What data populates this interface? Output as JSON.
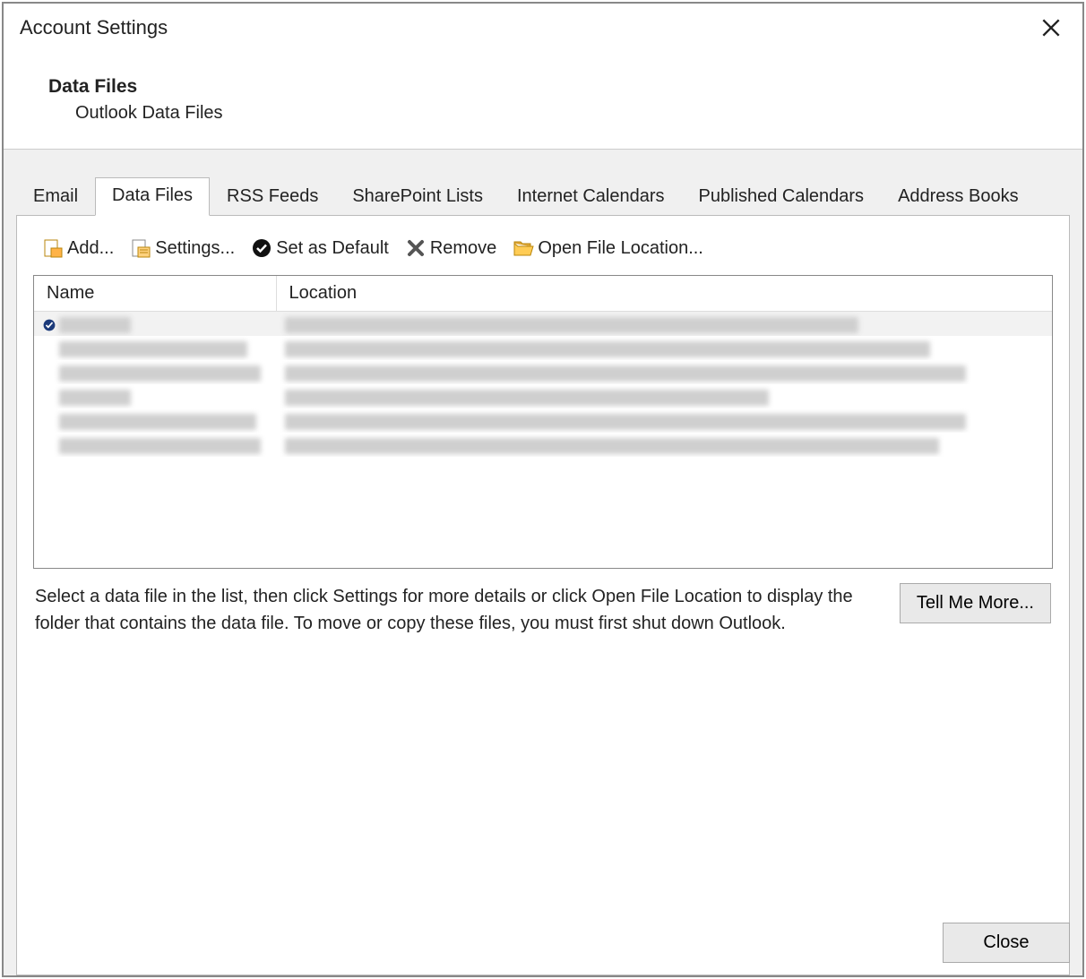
{
  "dialog": {
    "title": "Account Settings",
    "close_label": "Close"
  },
  "header": {
    "title": "Data Files",
    "subtitle": "Outlook Data Files"
  },
  "tabs": [
    {
      "id": "email",
      "label": "Email",
      "active": false
    },
    {
      "id": "data-files",
      "label": "Data Files",
      "active": true
    },
    {
      "id": "rss-feeds",
      "label": "RSS Feeds",
      "active": false
    },
    {
      "id": "sharepoint-lists",
      "label": "SharePoint Lists",
      "active": false
    },
    {
      "id": "internet-calendars",
      "label": "Internet Calendars",
      "active": false
    },
    {
      "id": "published-calendars",
      "label": "Published Calendars",
      "active": false
    },
    {
      "id": "address-books",
      "label": "Address Books",
      "active": false
    }
  ],
  "toolbar": {
    "add": "Add...",
    "settings": "Settings...",
    "set_default": "Set as Default",
    "remove": "Remove",
    "open_file_location": "Open File Location..."
  },
  "table": {
    "columns": {
      "name": "Name",
      "location": "Location"
    },
    "rows": [
      {
        "is_default": true,
        "name_redacted": true,
        "location_redacted": true,
        "selected": true,
        "name_w": 80,
        "loc_w": 640
      },
      {
        "is_default": false,
        "name_redacted": true,
        "location_redacted": true,
        "selected": false,
        "name_w": 210,
        "loc_w": 720
      },
      {
        "is_default": false,
        "name_redacted": true,
        "location_redacted": true,
        "selected": false,
        "name_w": 225,
        "loc_w": 760
      },
      {
        "is_default": false,
        "name_redacted": true,
        "location_redacted": true,
        "selected": false,
        "name_w": 80,
        "loc_w": 540
      },
      {
        "is_default": false,
        "name_redacted": true,
        "location_redacted": true,
        "selected": false,
        "name_w": 220,
        "loc_w": 760
      },
      {
        "is_default": false,
        "name_redacted": true,
        "location_redacted": true,
        "selected": false,
        "name_w": 225,
        "loc_w": 730
      }
    ]
  },
  "info": {
    "text": "Select a data file in the list, then click Settings for more details or click Open File Location to display the folder that contains the data file. To move or copy these files, you must first shut down Outlook.",
    "button": "Tell Me More..."
  }
}
